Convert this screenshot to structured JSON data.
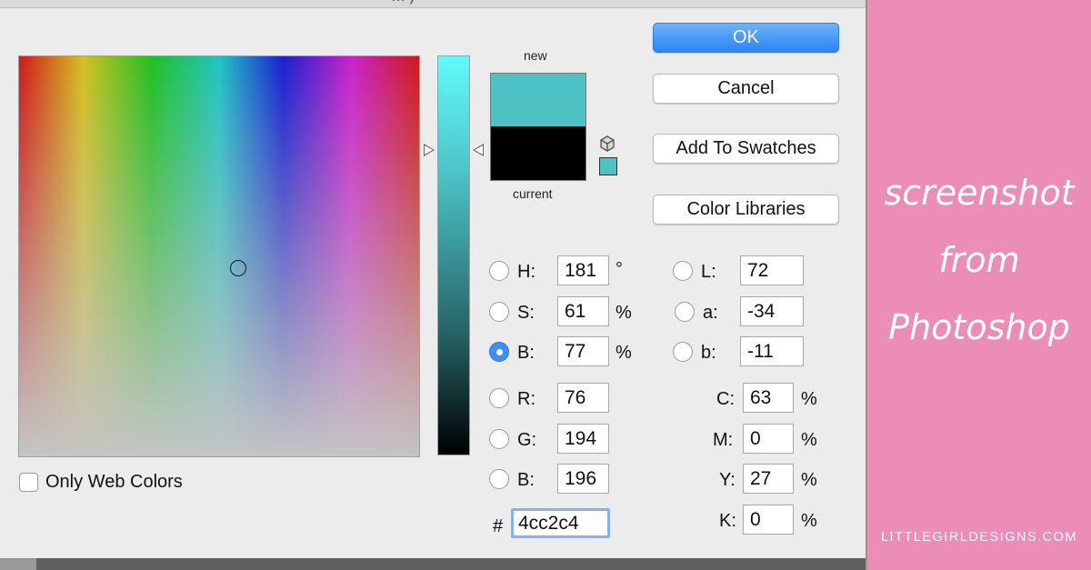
{
  "dialog": {
    "title_fragment": "… )",
    "colors": {
      "new": "#4cc2c4",
      "current": "#000000",
      "accent_button": "#2a84f5",
      "websafe_swatch": "#4cc2c4"
    },
    "new_label": "new",
    "current_label": "current",
    "buttons": {
      "ok": "OK",
      "cancel": "Cancel",
      "add_to_swatches": "Add To Swatches",
      "color_libraries": "Color Libraries"
    },
    "hsb": {
      "h_label": "H:",
      "h_value": "181",
      "h_unit": "°",
      "s_label": "S:",
      "s_value": "61",
      "s_unit": "%",
      "b_label": "B:",
      "b_value": "77",
      "b_unit": "%",
      "selected": "B"
    },
    "lab": {
      "l_label": "L:",
      "l_value": "72",
      "a_label": "a:",
      "a_value": "-34",
      "b_label": "b:",
      "b_value": "-11"
    },
    "rgb": {
      "r_label": "R:",
      "r_value": "76",
      "g_label": "G:",
      "g_value": "194",
      "b_label": "B:",
      "b_value": "196"
    },
    "cmyk": {
      "c_label": "C:",
      "c_value": "63",
      "c_unit": "%",
      "m_label": "M:",
      "m_value": "0",
      "m_unit": "%",
      "y_label": "Y:",
      "y_value": "27",
      "y_unit": "%",
      "k_label": "K:",
      "k_value": "0",
      "k_unit": "%"
    },
    "hex": {
      "label": "#",
      "value": "4cc2c4"
    },
    "only_web_colors": {
      "label": "Only Web Colors",
      "checked": false
    },
    "icons": {
      "gamut": "cube-icon",
      "websafe": "websafe-swatch-icon"
    }
  },
  "side_panel": {
    "background": "#ec8db6",
    "lines": [
      "screenshot",
      "from",
      "Photoshop"
    ],
    "credit": "LITTLEGIRLDESIGNS.COM"
  }
}
